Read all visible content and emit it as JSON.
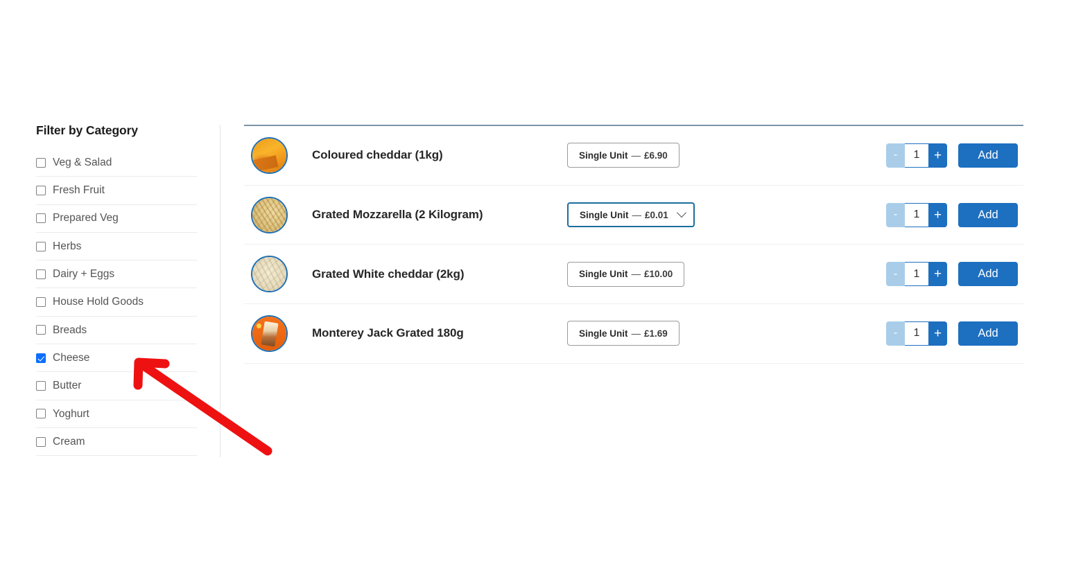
{
  "sidebar": {
    "title": "Filter by Category",
    "items": [
      {
        "label": "Veg & Salad",
        "checked": false
      },
      {
        "label": "Fresh Fruit",
        "checked": false
      },
      {
        "label": "Prepared Veg",
        "checked": false
      },
      {
        "label": "Herbs",
        "checked": false
      },
      {
        "label": "Dairy + Eggs",
        "checked": false
      },
      {
        "label": "House Hold Goods",
        "checked": false
      },
      {
        "label": "Breads",
        "checked": false
      },
      {
        "label": "Cheese",
        "checked": true
      },
      {
        "label": "Butter",
        "checked": false
      },
      {
        "label": "Yoghurt",
        "checked": false
      },
      {
        "label": "Cream",
        "checked": false
      }
    ]
  },
  "products": [
    {
      "name": "Coloured cheddar (1kg)",
      "unit_label": "Single Unit",
      "separator": "—",
      "price": "£6.90",
      "is_select": false,
      "quantity": "1",
      "minus_label": "-",
      "plus_label": "+",
      "add_label": "Add",
      "thumb": "cheddar-block-image"
    },
    {
      "name": "Grated Mozzarella (2 Kilogram)",
      "unit_label": "Single Unit",
      "separator": "—",
      "price": "£0.01",
      "is_select": true,
      "quantity": "1",
      "minus_label": "-",
      "plus_label": "+",
      "add_label": "Add",
      "thumb": "grated-mozzarella-image"
    },
    {
      "name": "Grated White cheddar (2kg)",
      "unit_label": "Single Unit",
      "separator": "—",
      "price": "£10.00",
      "is_select": false,
      "quantity": "1",
      "minus_label": "-",
      "plus_label": "+",
      "add_label": "Add",
      "thumb": "grated-white-cheddar-image"
    },
    {
      "name": "Monterey Jack Grated 180g",
      "unit_label": "Single Unit",
      "separator": "—",
      "price": "£1.69",
      "is_select": false,
      "quantity": "1",
      "minus_label": "-",
      "plus_label": "+",
      "add_label": "Add",
      "thumb": "monterey-jack-pack-image"
    }
  ],
  "annotation": {
    "type": "red-arrow",
    "points_to": "Cheese",
    "color": "#ee1111"
  },
  "colors": {
    "accent_blue": "#1d6fc0",
    "checkbox_blue": "#0d6efd",
    "disabled_blue": "#a9cde9",
    "select_focus_border": "#1b6d9e",
    "annotation_red": "#ee1111"
  }
}
